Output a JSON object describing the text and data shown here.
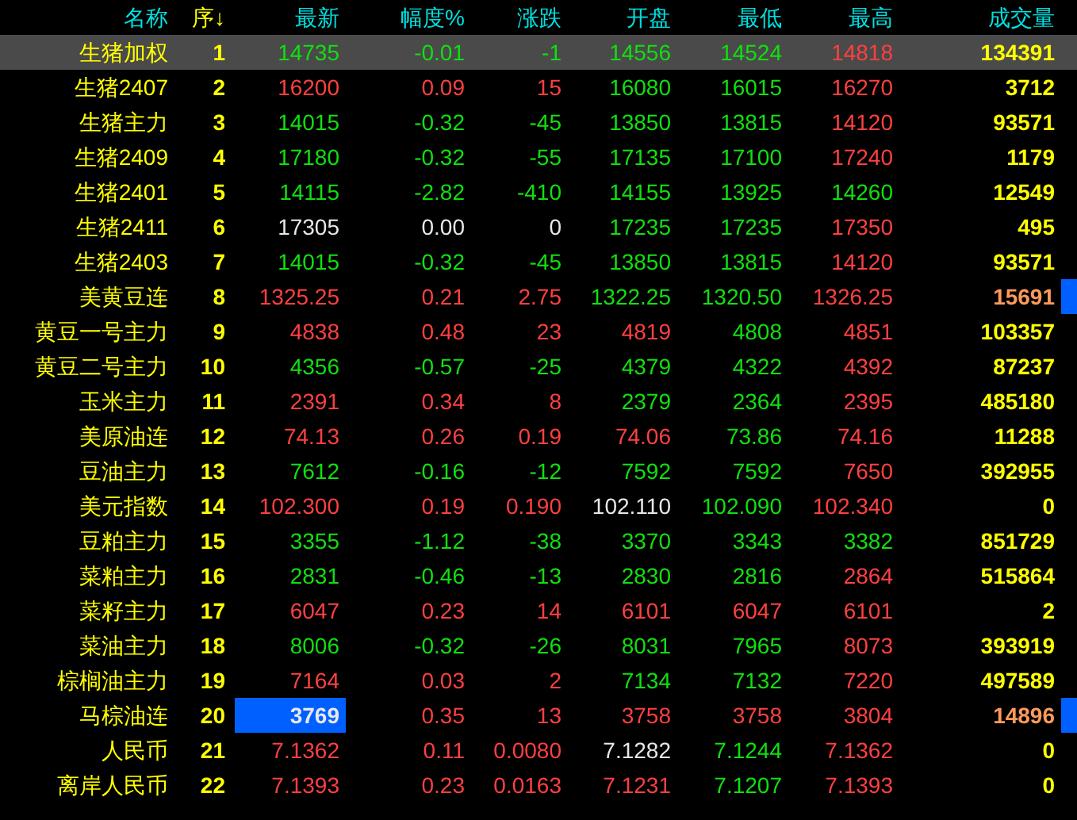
{
  "columns": [
    {
      "label": "名称",
      "selected": false
    },
    {
      "label": "序",
      "selected": true,
      "sort_arrow": "↓"
    },
    {
      "label": "最新",
      "selected": false
    },
    {
      "label": "幅度%",
      "selected": false
    },
    {
      "label": "涨跌",
      "selected": false
    },
    {
      "label": "开盘",
      "selected": false
    },
    {
      "label": "最低",
      "selected": false
    },
    {
      "label": "最高",
      "selected": false
    },
    {
      "label": "成交量",
      "selected": false
    }
  ],
  "rows": [
    {
      "name": "生猪加权",
      "seq": "1",
      "selected": true,
      "flagged": false,
      "latest_highlighted": false,
      "cells": [
        {
          "text": "14735",
          "kind": "down"
        },
        {
          "text": "-0.01",
          "kind": "down"
        },
        {
          "text": "-1",
          "kind": "down"
        },
        {
          "text": "14556",
          "kind": "down"
        },
        {
          "text": "14524",
          "kind": "down"
        },
        {
          "text": "14818",
          "kind": "up"
        },
        {
          "text": "134391",
          "kind": "volume"
        }
      ]
    },
    {
      "name": "生猪2407",
      "seq": "2",
      "selected": false,
      "flagged": false,
      "latest_highlighted": false,
      "cells": [
        {
          "text": "16200",
          "kind": "up"
        },
        {
          "text": "0.09",
          "kind": "up"
        },
        {
          "text": "15",
          "kind": "up"
        },
        {
          "text": "16080",
          "kind": "down"
        },
        {
          "text": "16015",
          "kind": "down"
        },
        {
          "text": "16270",
          "kind": "up"
        },
        {
          "text": "3712",
          "kind": "volume"
        }
      ]
    },
    {
      "name": "生猪主力",
      "seq": "3",
      "selected": false,
      "flagged": false,
      "latest_highlighted": false,
      "cells": [
        {
          "text": "14015",
          "kind": "down"
        },
        {
          "text": "-0.32",
          "kind": "down"
        },
        {
          "text": "-45",
          "kind": "down"
        },
        {
          "text": "13850",
          "kind": "down"
        },
        {
          "text": "13815",
          "kind": "down"
        },
        {
          "text": "14120",
          "kind": "up"
        },
        {
          "text": "93571",
          "kind": "volume"
        }
      ]
    },
    {
      "name": "生猪2409",
      "seq": "4",
      "selected": false,
      "flagged": false,
      "latest_highlighted": false,
      "cells": [
        {
          "text": "17180",
          "kind": "down"
        },
        {
          "text": "-0.32",
          "kind": "down"
        },
        {
          "text": "-55",
          "kind": "down"
        },
        {
          "text": "17135",
          "kind": "down"
        },
        {
          "text": "17100",
          "kind": "down"
        },
        {
          "text": "17240",
          "kind": "up"
        },
        {
          "text": "1179",
          "kind": "volume"
        }
      ]
    },
    {
      "name": "生猪2401",
      "seq": "5",
      "selected": false,
      "flagged": false,
      "latest_highlighted": false,
      "cells": [
        {
          "text": "14115",
          "kind": "down"
        },
        {
          "text": "-2.82",
          "kind": "down"
        },
        {
          "text": "-410",
          "kind": "down"
        },
        {
          "text": "14155",
          "kind": "down"
        },
        {
          "text": "13925",
          "kind": "down"
        },
        {
          "text": "14260",
          "kind": "down"
        },
        {
          "text": "12549",
          "kind": "volume"
        }
      ]
    },
    {
      "name": "生猪2411",
      "seq": "6",
      "selected": false,
      "flagged": false,
      "latest_highlighted": false,
      "cells": [
        {
          "text": "17305",
          "kind": "flat"
        },
        {
          "text": "0.00",
          "kind": "flat"
        },
        {
          "text": "0",
          "kind": "flat"
        },
        {
          "text": "17235",
          "kind": "down"
        },
        {
          "text": "17235",
          "kind": "down"
        },
        {
          "text": "17350",
          "kind": "up"
        },
        {
          "text": "495",
          "kind": "volume"
        }
      ]
    },
    {
      "name": "生猪2403",
      "seq": "7",
      "selected": false,
      "flagged": false,
      "latest_highlighted": false,
      "cells": [
        {
          "text": "14015",
          "kind": "down"
        },
        {
          "text": "-0.32",
          "kind": "down"
        },
        {
          "text": "-45",
          "kind": "down"
        },
        {
          "text": "13850",
          "kind": "down"
        },
        {
          "text": "13815",
          "kind": "down"
        },
        {
          "text": "14120",
          "kind": "up"
        },
        {
          "text": "93571",
          "kind": "volume"
        }
      ]
    },
    {
      "name": "美黄豆连",
      "seq": "8",
      "selected": false,
      "flagged": true,
      "latest_highlighted": false,
      "cells": [
        {
          "text": "1325.25",
          "kind": "up"
        },
        {
          "text": "0.21",
          "kind": "up"
        },
        {
          "text": "2.75",
          "kind": "up"
        },
        {
          "text": "1322.25",
          "kind": "down"
        },
        {
          "text": "1320.50",
          "kind": "down"
        },
        {
          "text": "1326.25",
          "kind": "up"
        },
        {
          "text": "15691",
          "kind": "alert"
        }
      ]
    },
    {
      "name": "黄豆一号主力",
      "seq": "9",
      "selected": false,
      "flagged": false,
      "latest_highlighted": false,
      "cells": [
        {
          "text": "4838",
          "kind": "up"
        },
        {
          "text": "0.48",
          "kind": "up"
        },
        {
          "text": "23",
          "kind": "up"
        },
        {
          "text": "4819",
          "kind": "up"
        },
        {
          "text": "4808",
          "kind": "down"
        },
        {
          "text": "4851",
          "kind": "up"
        },
        {
          "text": "103357",
          "kind": "volume"
        }
      ]
    },
    {
      "name": "黄豆二号主力",
      "seq": "10",
      "selected": false,
      "flagged": false,
      "latest_highlighted": false,
      "cells": [
        {
          "text": "4356",
          "kind": "down"
        },
        {
          "text": "-0.57",
          "kind": "down"
        },
        {
          "text": "-25",
          "kind": "down"
        },
        {
          "text": "4379",
          "kind": "down"
        },
        {
          "text": "4322",
          "kind": "down"
        },
        {
          "text": "4392",
          "kind": "up"
        },
        {
          "text": "87237",
          "kind": "volume"
        }
      ]
    },
    {
      "name": "玉米主力",
      "seq": "11",
      "selected": false,
      "flagged": false,
      "latest_highlighted": false,
      "cells": [
        {
          "text": "2391",
          "kind": "up"
        },
        {
          "text": "0.34",
          "kind": "up"
        },
        {
          "text": "8",
          "kind": "up"
        },
        {
          "text": "2379",
          "kind": "down"
        },
        {
          "text": "2364",
          "kind": "down"
        },
        {
          "text": "2395",
          "kind": "up"
        },
        {
          "text": "485180",
          "kind": "volume"
        }
      ]
    },
    {
      "name": "美原油连",
      "seq": "12",
      "selected": false,
      "flagged": false,
      "latest_highlighted": false,
      "cells": [
        {
          "text": "74.13",
          "kind": "up"
        },
        {
          "text": "0.26",
          "kind": "up"
        },
        {
          "text": "0.19",
          "kind": "up"
        },
        {
          "text": "74.06",
          "kind": "up"
        },
        {
          "text": "73.86",
          "kind": "down"
        },
        {
          "text": "74.16",
          "kind": "up"
        },
        {
          "text": "11288",
          "kind": "volume"
        }
      ]
    },
    {
      "name": "豆油主力",
      "seq": "13",
      "selected": false,
      "flagged": false,
      "latest_highlighted": false,
      "cells": [
        {
          "text": "7612",
          "kind": "down"
        },
        {
          "text": "-0.16",
          "kind": "down"
        },
        {
          "text": "-12",
          "kind": "down"
        },
        {
          "text": "7592",
          "kind": "down"
        },
        {
          "text": "7592",
          "kind": "down"
        },
        {
          "text": "7650",
          "kind": "up"
        },
        {
          "text": "392955",
          "kind": "volume"
        }
      ]
    },
    {
      "name": "美元指数",
      "seq": "14",
      "selected": false,
      "flagged": false,
      "latest_highlighted": false,
      "cells": [
        {
          "text": "102.300",
          "kind": "up"
        },
        {
          "text": "0.19",
          "kind": "up"
        },
        {
          "text": "0.190",
          "kind": "up"
        },
        {
          "text": "102.110",
          "kind": "flat"
        },
        {
          "text": "102.090",
          "kind": "down"
        },
        {
          "text": "102.340",
          "kind": "up"
        },
        {
          "text": "0",
          "kind": "volume"
        }
      ]
    },
    {
      "name": "豆粕主力",
      "seq": "15",
      "selected": false,
      "flagged": false,
      "latest_highlighted": false,
      "cells": [
        {
          "text": "3355",
          "kind": "down"
        },
        {
          "text": "-1.12",
          "kind": "down"
        },
        {
          "text": "-38",
          "kind": "down"
        },
        {
          "text": "3370",
          "kind": "down"
        },
        {
          "text": "3343",
          "kind": "down"
        },
        {
          "text": "3382",
          "kind": "down"
        },
        {
          "text": "851729",
          "kind": "volume"
        }
      ]
    },
    {
      "name": "菜粕主力",
      "seq": "16",
      "selected": false,
      "flagged": false,
      "latest_highlighted": false,
      "cells": [
        {
          "text": "2831",
          "kind": "down"
        },
        {
          "text": "-0.46",
          "kind": "down"
        },
        {
          "text": "-13",
          "kind": "down"
        },
        {
          "text": "2830",
          "kind": "down"
        },
        {
          "text": "2816",
          "kind": "down"
        },
        {
          "text": "2864",
          "kind": "up"
        },
        {
          "text": "515864",
          "kind": "volume"
        }
      ]
    },
    {
      "name": "菜籽主力",
      "seq": "17",
      "selected": false,
      "flagged": false,
      "latest_highlighted": false,
      "cells": [
        {
          "text": "6047",
          "kind": "up"
        },
        {
          "text": "0.23",
          "kind": "up"
        },
        {
          "text": "14",
          "kind": "up"
        },
        {
          "text": "6101",
          "kind": "up"
        },
        {
          "text": "6047",
          "kind": "up"
        },
        {
          "text": "6101",
          "kind": "up"
        },
        {
          "text": "2",
          "kind": "volume"
        }
      ]
    },
    {
      "name": "菜油主力",
      "seq": "18",
      "selected": false,
      "flagged": false,
      "latest_highlighted": false,
      "cells": [
        {
          "text": "8006",
          "kind": "down"
        },
        {
          "text": "-0.32",
          "kind": "down"
        },
        {
          "text": "-26",
          "kind": "down"
        },
        {
          "text": "8031",
          "kind": "down"
        },
        {
          "text": "7965",
          "kind": "down"
        },
        {
          "text": "8073",
          "kind": "up"
        },
        {
          "text": "393919",
          "kind": "volume"
        }
      ]
    },
    {
      "name": "棕榈油主力",
      "seq": "19",
      "selected": false,
      "flagged": false,
      "latest_highlighted": false,
      "cells": [
        {
          "text": "7164",
          "kind": "up"
        },
        {
          "text": "0.03",
          "kind": "up"
        },
        {
          "text": "2",
          "kind": "up"
        },
        {
          "text": "7134",
          "kind": "down"
        },
        {
          "text": "7132",
          "kind": "down"
        },
        {
          "text": "7220",
          "kind": "up"
        },
        {
          "text": "497589",
          "kind": "volume"
        }
      ]
    },
    {
      "name": "马棕油连",
      "seq": "20",
      "selected": false,
      "flagged": true,
      "latest_highlighted": true,
      "cells": [
        {
          "text": "3769",
          "kind": "flat"
        },
        {
          "text": "0.35",
          "kind": "up"
        },
        {
          "text": "13",
          "kind": "up"
        },
        {
          "text": "3758",
          "kind": "up"
        },
        {
          "text": "3758",
          "kind": "up"
        },
        {
          "text": "3804",
          "kind": "up"
        },
        {
          "text": "14896",
          "kind": "alert"
        }
      ]
    },
    {
      "name": "人民币",
      "seq": "21",
      "selected": false,
      "flagged": false,
      "latest_highlighted": false,
      "cells": [
        {
          "text": "7.1362",
          "kind": "up"
        },
        {
          "text": "0.11",
          "kind": "up"
        },
        {
          "text": "0.0080",
          "kind": "up"
        },
        {
          "text": "7.1282",
          "kind": "flat"
        },
        {
          "text": "7.1244",
          "kind": "down"
        },
        {
          "text": "7.1362",
          "kind": "up"
        },
        {
          "text": "0",
          "kind": "volume"
        }
      ]
    },
    {
      "name": "离岸人民币",
      "seq": "22",
      "selected": false,
      "flagged": false,
      "latest_highlighted": false,
      "cells": [
        {
          "text": "7.1393",
          "kind": "up"
        },
        {
          "text": "0.23",
          "kind": "up"
        },
        {
          "text": "0.0163",
          "kind": "up"
        },
        {
          "text": "7.1231",
          "kind": "up"
        },
        {
          "text": "7.1207",
          "kind": "down"
        },
        {
          "text": "7.1393",
          "kind": "up"
        },
        {
          "text": "0",
          "kind": "volume"
        }
      ]
    }
  ]
}
